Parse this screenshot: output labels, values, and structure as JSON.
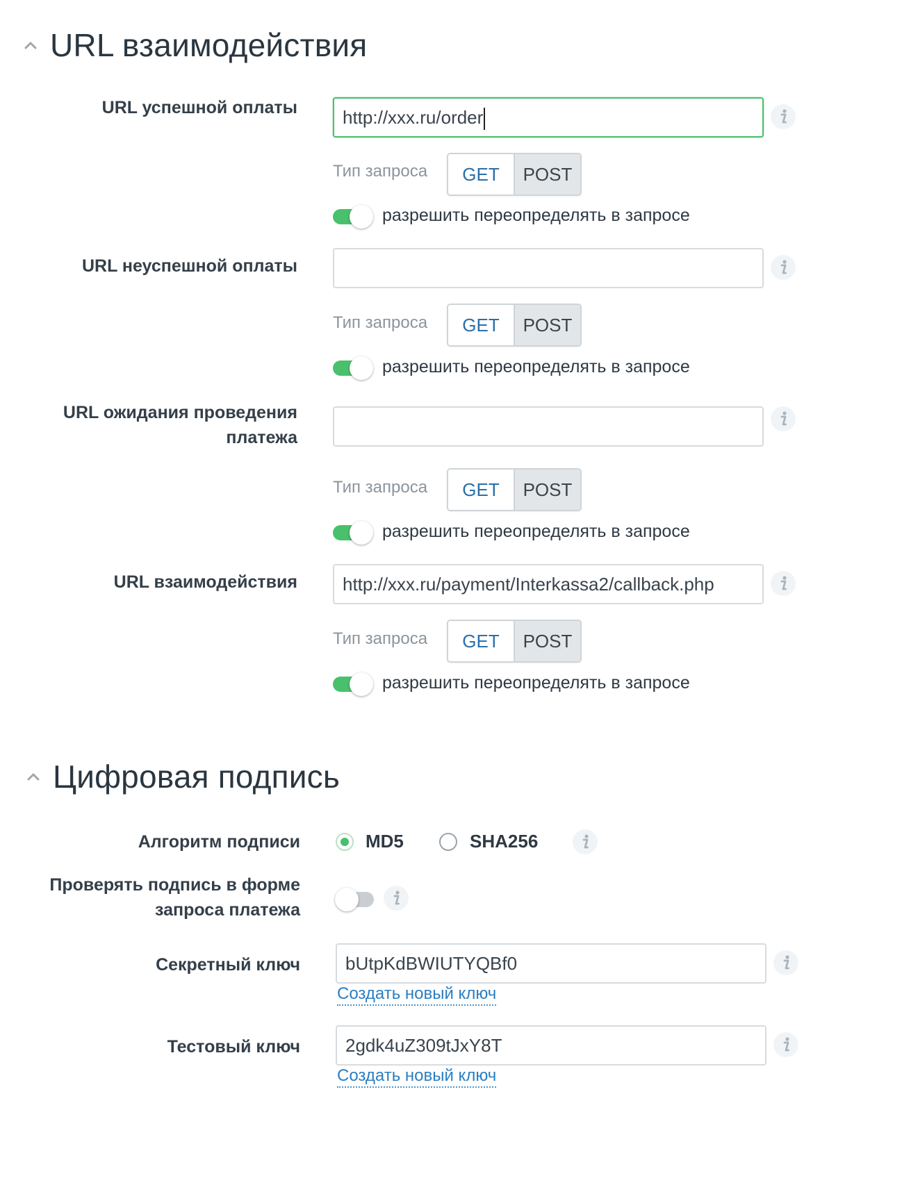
{
  "sections": {
    "urls": {
      "title": "URL взаимодействия"
    },
    "signature": {
      "title": "Цифровая подпись"
    }
  },
  "request_type_label": "Тип запроса",
  "methods": {
    "get": "GET",
    "post": "POST"
  },
  "allow_override_label": "разрешить переопределять в запросе",
  "url_fields": [
    {
      "label": "URL успешной оплаты",
      "value": "http://xxx.ru/order",
      "focused": true,
      "override": true
    },
    {
      "label": "URL неуспешной оплаты",
      "value": "",
      "override": true
    },
    {
      "label": "URL ожидания проведения платежа",
      "value": "",
      "override": true
    },
    {
      "label": "URL взаимодействия",
      "value": "http://xxx.ru/payment/Interkassa2/callback.php",
      "override": true
    }
  ],
  "signature": {
    "algorithm_label": "Алгоритм подписи",
    "algorithms": [
      {
        "label": "MD5",
        "checked": true
      },
      {
        "label": "SHA256",
        "checked": false
      }
    ],
    "verify_label": "Проверять подпись в форме запроса платежа",
    "verify_enabled": false,
    "secret_key_label": "Секретный ключ",
    "secret_key_value": "bUtpKdBWIUTYQBf0",
    "test_key_label": "Тестовый ключ",
    "test_key_value": "2gdk4uZ309tJxY8T",
    "generate_key_link": "Создать новый ключ"
  },
  "colors": {
    "accent_green": "#49c06c",
    "link_blue": "#2b7ec1",
    "get_blue": "#2a6fa8",
    "focus_border": "#4dbf6e"
  },
  "icons": [
    "chevron-up-icon",
    "info-icon"
  ]
}
